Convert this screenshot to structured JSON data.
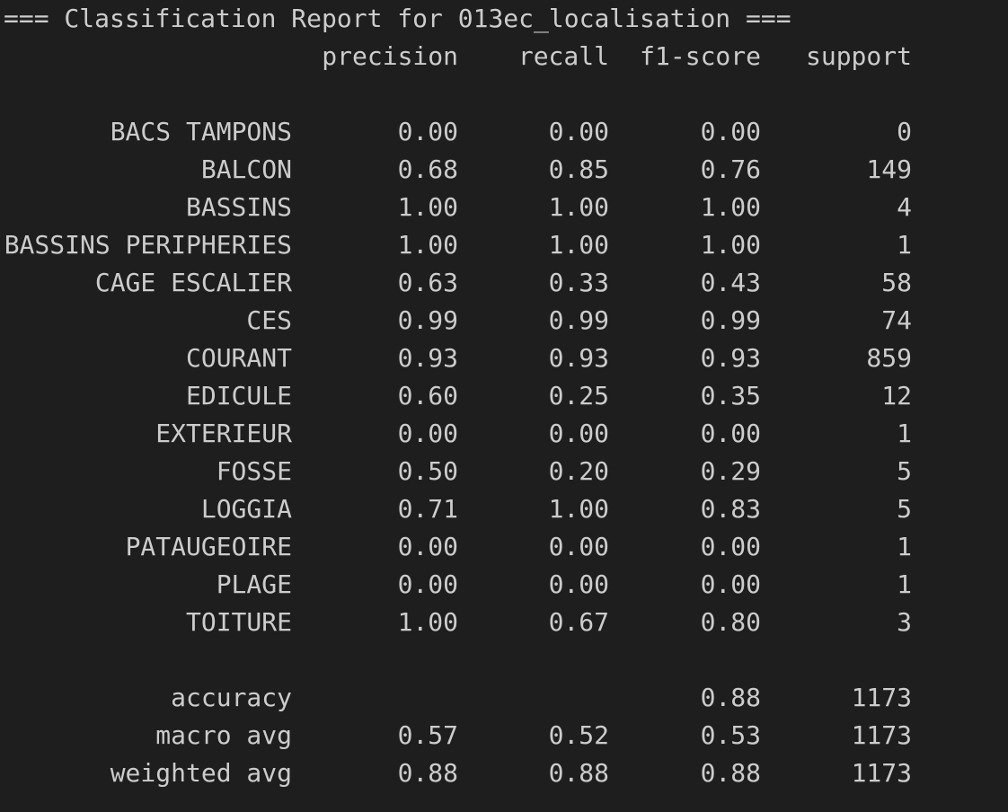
{
  "title": "=== Classification Report for 013ec_localisation ===",
  "headers": {
    "precision": "precision",
    "recall": "recall",
    "f1": "f1-score",
    "support": "support"
  },
  "rows": [
    {
      "label": "BACS TAMPONS",
      "precision": "0.00",
      "recall": "0.00",
      "f1": "0.00",
      "support": "0"
    },
    {
      "label": "BALCON",
      "precision": "0.68",
      "recall": "0.85",
      "f1": "0.76",
      "support": "149"
    },
    {
      "label": "BASSINS",
      "precision": "1.00",
      "recall": "1.00",
      "f1": "1.00",
      "support": "4"
    },
    {
      "label": "BASSINS PERIPHERIES",
      "precision": "1.00",
      "recall": "1.00",
      "f1": "1.00",
      "support": "1"
    },
    {
      "label": "CAGE ESCALIER",
      "precision": "0.63",
      "recall": "0.33",
      "f1": "0.43",
      "support": "58"
    },
    {
      "label": "CES",
      "precision": "0.99",
      "recall": "0.99",
      "f1": "0.99",
      "support": "74"
    },
    {
      "label": "COURANT",
      "precision": "0.93",
      "recall": "0.93",
      "f1": "0.93",
      "support": "859"
    },
    {
      "label": "EDICULE",
      "precision": "0.60",
      "recall": "0.25",
      "f1": "0.35",
      "support": "12"
    },
    {
      "label": "EXTERIEUR",
      "precision": "0.00",
      "recall": "0.00",
      "f1": "0.00",
      "support": "1"
    },
    {
      "label": "FOSSE",
      "precision": "0.50",
      "recall": "0.20",
      "f1": "0.29",
      "support": "5"
    },
    {
      "label": "LOGGIA",
      "precision": "0.71",
      "recall": "1.00",
      "f1": "0.83",
      "support": "5"
    },
    {
      "label": "PATAUGEOIRE",
      "precision": "0.00",
      "recall": "0.00",
      "f1": "0.00",
      "support": "1"
    },
    {
      "label": "PLAGE",
      "precision": "0.00",
      "recall": "0.00",
      "f1": "0.00",
      "support": "1"
    },
    {
      "label": "TOITURE",
      "precision": "1.00",
      "recall": "0.67",
      "f1": "0.80",
      "support": "3"
    }
  ],
  "summary": [
    {
      "label": "accuracy",
      "precision": "",
      "recall": "",
      "f1": "0.88",
      "support": "1173"
    },
    {
      "label": "macro avg",
      "precision": "0.57",
      "recall": "0.52",
      "f1": "0.53",
      "support": "1173"
    },
    {
      "label": "weighted avg",
      "precision": "0.88",
      "recall": "0.88",
      "f1": "0.88",
      "support": "1173"
    }
  ],
  "colors": {
    "background": "#1e1e1e",
    "text": "#cccccc"
  }
}
